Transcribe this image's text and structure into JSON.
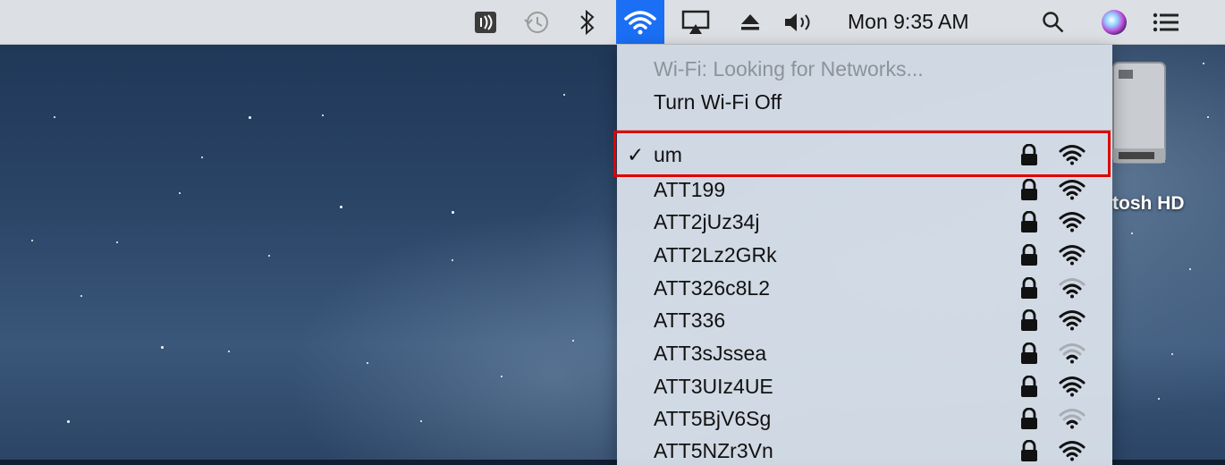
{
  "menubar": {
    "icons": [
      "voiceover-icon",
      "time-machine-icon",
      "bluetooth-icon",
      "wifi-icon",
      "airplay-icon",
      "eject-icon",
      "volume-icon"
    ],
    "clock": "Mon 9:35 AM",
    "right_icons": [
      "spotlight-search-icon",
      "siri-icon",
      "notification-center-icon"
    ],
    "active_color": "#1a6ff5"
  },
  "wifi_menu": {
    "status": "Wi-Fi: Looking for Networks...",
    "toggle_label": "Turn Wi-Fi Off",
    "networks": [
      {
        "name": "um",
        "connected": true,
        "locked": true,
        "signal": 3
      },
      {
        "name": "ATT199",
        "connected": false,
        "locked": true,
        "signal": 3
      },
      {
        "name": "ATT2jUz34j",
        "connected": false,
        "locked": true,
        "signal": 3
      },
      {
        "name": "ATT2Lz2GRk",
        "connected": false,
        "locked": true,
        "signal": 3
      },
      {
        "name": "ATT326c8L2",
        "connected": false,
        "locked": true,
        "signal": 2
      },
      {
        "name": "ATT336",
        "connected": false,
        "locked": true,
        "signal": 3
      },
      {
        "name": "ATT3sJssea",
        "connected": false,
        "locked": true,
        "signal": 1
      },
      {
        "name": "ATT3UIz4UE",
        "connected": false,
        "locked": true,
        "signal": 3
      },
      {
        "name": "ATT5BjV6Sg",
        "connected": false,
        "locked": true,
        "signal": 1
      },
      {
        "name": "ATT5NZr3Vn",
        "connected": false,
        "locked": true,
        "signal": 3
      }
    ],
    "check_mark": "✓"
  },
  "desktop": {
    "drive_label": "tosh HD"
  },
  "annotation": {
    "highlight_color": "#e00000"
  }
}
